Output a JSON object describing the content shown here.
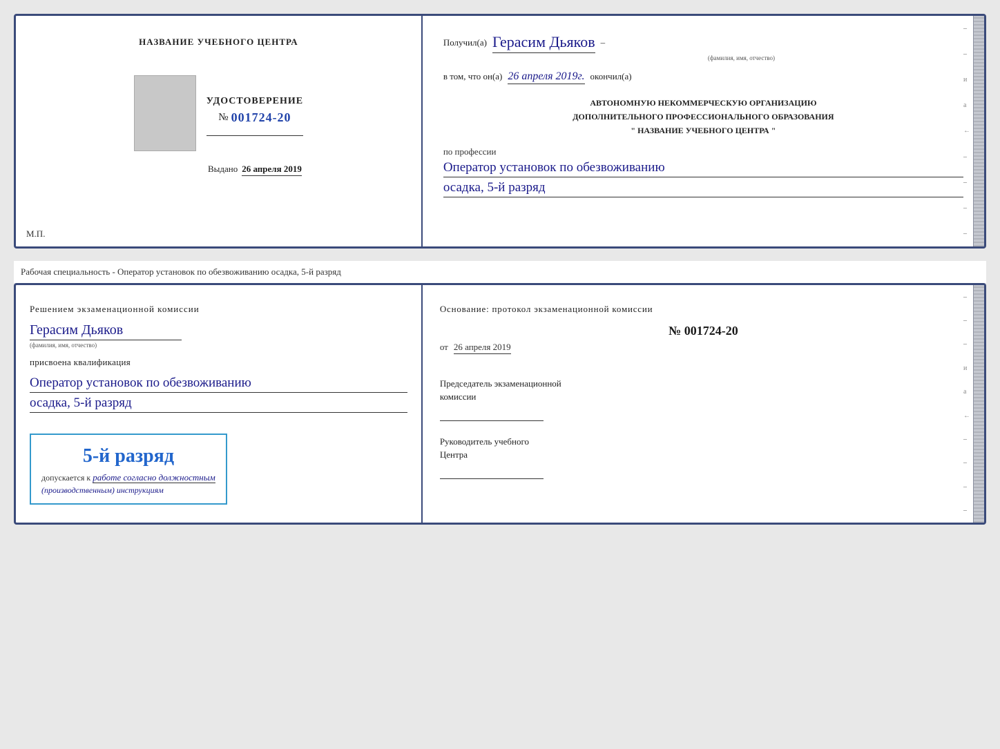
{
  "top_document": {
    "left": {
      "section_label": "НАЗВАНИЕ УЧЕБНОГО ЦЕНТРА",
      "photo_alt": "фото",
      "cert_title": "УДОСТОВЕРЕНИЕ",
      "cert_number_prefix": "№",
      "cert_number": "001724-20",
      "issued_label": "Выдано",
      "issued_date": "26 апреля 2019",
      "mp_label": "М.П."
    },
    "right": {
      "received_label": "Получил(а)",
      "recipient_name": "Герасим Дьяков",
      "recipient_subtitle": "(фамилия, имя, отчество)",
      "dash": "–",
      "body1": "в том, что он(а)",
      "completion_date": "26 апреля 2019г.",
      "completed_label": "окончил(а)",
      "org_block": "АВТОНОМНУЮ НЕКОММЕРЧЕСКУЮ ОРГАНИЗАЦИЮ\nДОПОЛНИТЕЛЬНОГО ПРОФЕССИОНАЛЬНОГО ОБРАЗОВАНИЯ\n\" НАЗВАНИЕ УЧЕБНОГО ЦЕНТРА \"",
      "profession_label": "по профессии",
      "profession_line1": "Оператор установок по обезвоживанию",
      "profession_line2": "осадка, 5-й разряд"
    }
  },
  "between_text": "Рабочая специальность - Оператор установок по обезвоживанию осадка, 5-й разряд",
  "bottom_document": {
    "left": {
      "decision_text": "Решением экзаменационной комиссии",
      "person_name": "Герасим Дьяков",
      "person_subtitle": "(фамилия, имя, отчество)",
      "assigned_label": "присвоена квалификация",
      "qualification_line1": "Оператор установок по обезвоживанию",
      "qualification_line2": "осадка, 5-й разряд",
      "rank_box_text": "5-й разряд",
      "allowed_prefix": "допускается к",
      "allowed_handwritten": "работе согласно должностным",
      "allowed_suffix": "(производственным) инструкциям"
    },
    "right": {
      "basis_label": "Основание: протокол экзаменационной комиссии",
      "protocol_number": "№ 001724-20",
      "date_prefix": "от",
      "protocol_date": "26 апреля 2019",
      "chairman_label": "Председатель экзаменационной\nкомиссии",
      "director_label": "Руководитель учебного\nЦентра"
    }
  }
}
